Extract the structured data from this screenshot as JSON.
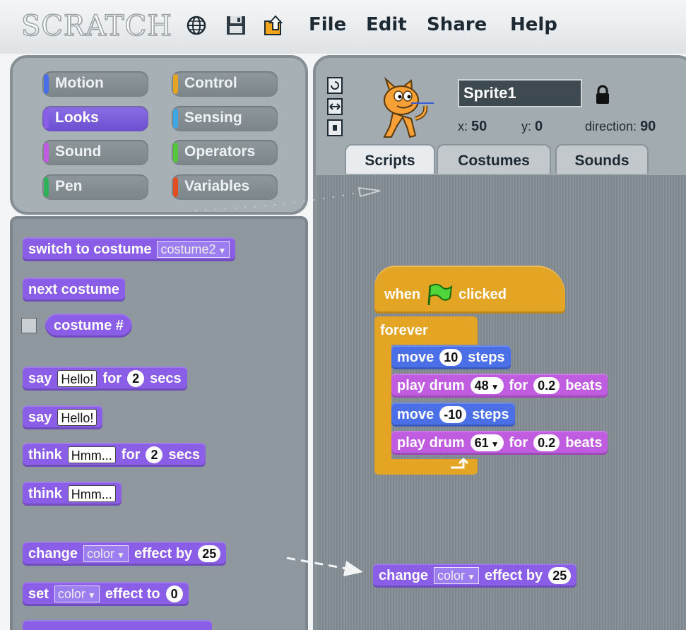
{
  "app": {
    "logo": "SCRATCH",
    "menu": [
      "File",
      "Edit",
      "Share",
      "Help"
    ],
    "toolbar_icons": [
      "globe-icon",
      "save-icon",
      "share-icon"
    ]
  },
  "categories": [
    {
      "label": "Motion",
      "color": "#4a6fe6"
    },
    {
      "label": "Control",
      "color": "#e3a523"
    },
    {
      "label": "Looks",
      "color": "#8a5ee6",
      "active": true
    },
    {
      "label": "Sensing",
      "color": "#3fa6e6"
    },
    {
      "label": "Sound",
      "color": "#c05ce0"
    },
    {
      "label": "Operators",
      "color": "#54c63e"
    },
    {
      "label": "Pen",
      "color": "#2fb05a"
    },
    {
      "label": "Variables",
      "color": "#e04e22"
    }
  ],
  "palette": {
    "switch_costume": {
      "label": "switch to costume",
      "value": "costume2"
    },
    "next_costume": {
      "label": "next costume"
    },
    "costume_num": {
      "label": "costume #"
    },
    "say_for": {
      "l1": "say",
      "text": "Hello!",
      "l2": "for",
      "num": "2",
      "l3": "secs"
    },
    "say": {
      "l1": "say",
      "text": "Hello!"
    },
    "think_for": {
      "l1": "think",
      "text": "Hmm...",
      "l2": "for",
      "num": "2",
      "l3": "secs"
    },
    "think": {
      "l1": "think",
      "text": "Hmm..."
    },
    "change_effect": {
      "l1": "change",
      "dd": "color",
      "l2": "effect by",
      "num": "25"
    },
    "set_effect": {
      "l1": "set",
      "dd": "color",
      "l2": "effect to",
      "num": "0"
    }
  },
  "sprite": {
    "name": "Sprite1",
    "x_label": "x:",
    "x": "50",
    "y_label": "y:",
    "y": "0",
    "direction_label": "direction:",
    "direction": "90"
  },
  "tabs": [
    "Scripts",
    "Costumes",
    "Sounds"
  ],
  "script": {
    "hat": {
      "l1": "when",
      "l2": "clicked"
    },
    "forever": "forever",
    "move1": {
      "l1": "move",
      "num": "10",
      "l2": "steps"
    },
    "drum1": {
      "l1": "play drum",
      "num": "48",
      "l2": "for",
      "beats": "0.2",
      "l3": "beats"
    },
    "move2": {
      "l1": "move",
      "num": "-10",
      "l2": "steps"
    },
    "drum2": {
      "l1": "play drum",
      "num": "61",
      "l2": "for",
      "beats": "0.2",
      "l3": "beats"
    },
    "dragged": {
      "l1": "change",
      "dd": "color",
      "l2": "effect by",
      "num": "25"
    }
  }
}
